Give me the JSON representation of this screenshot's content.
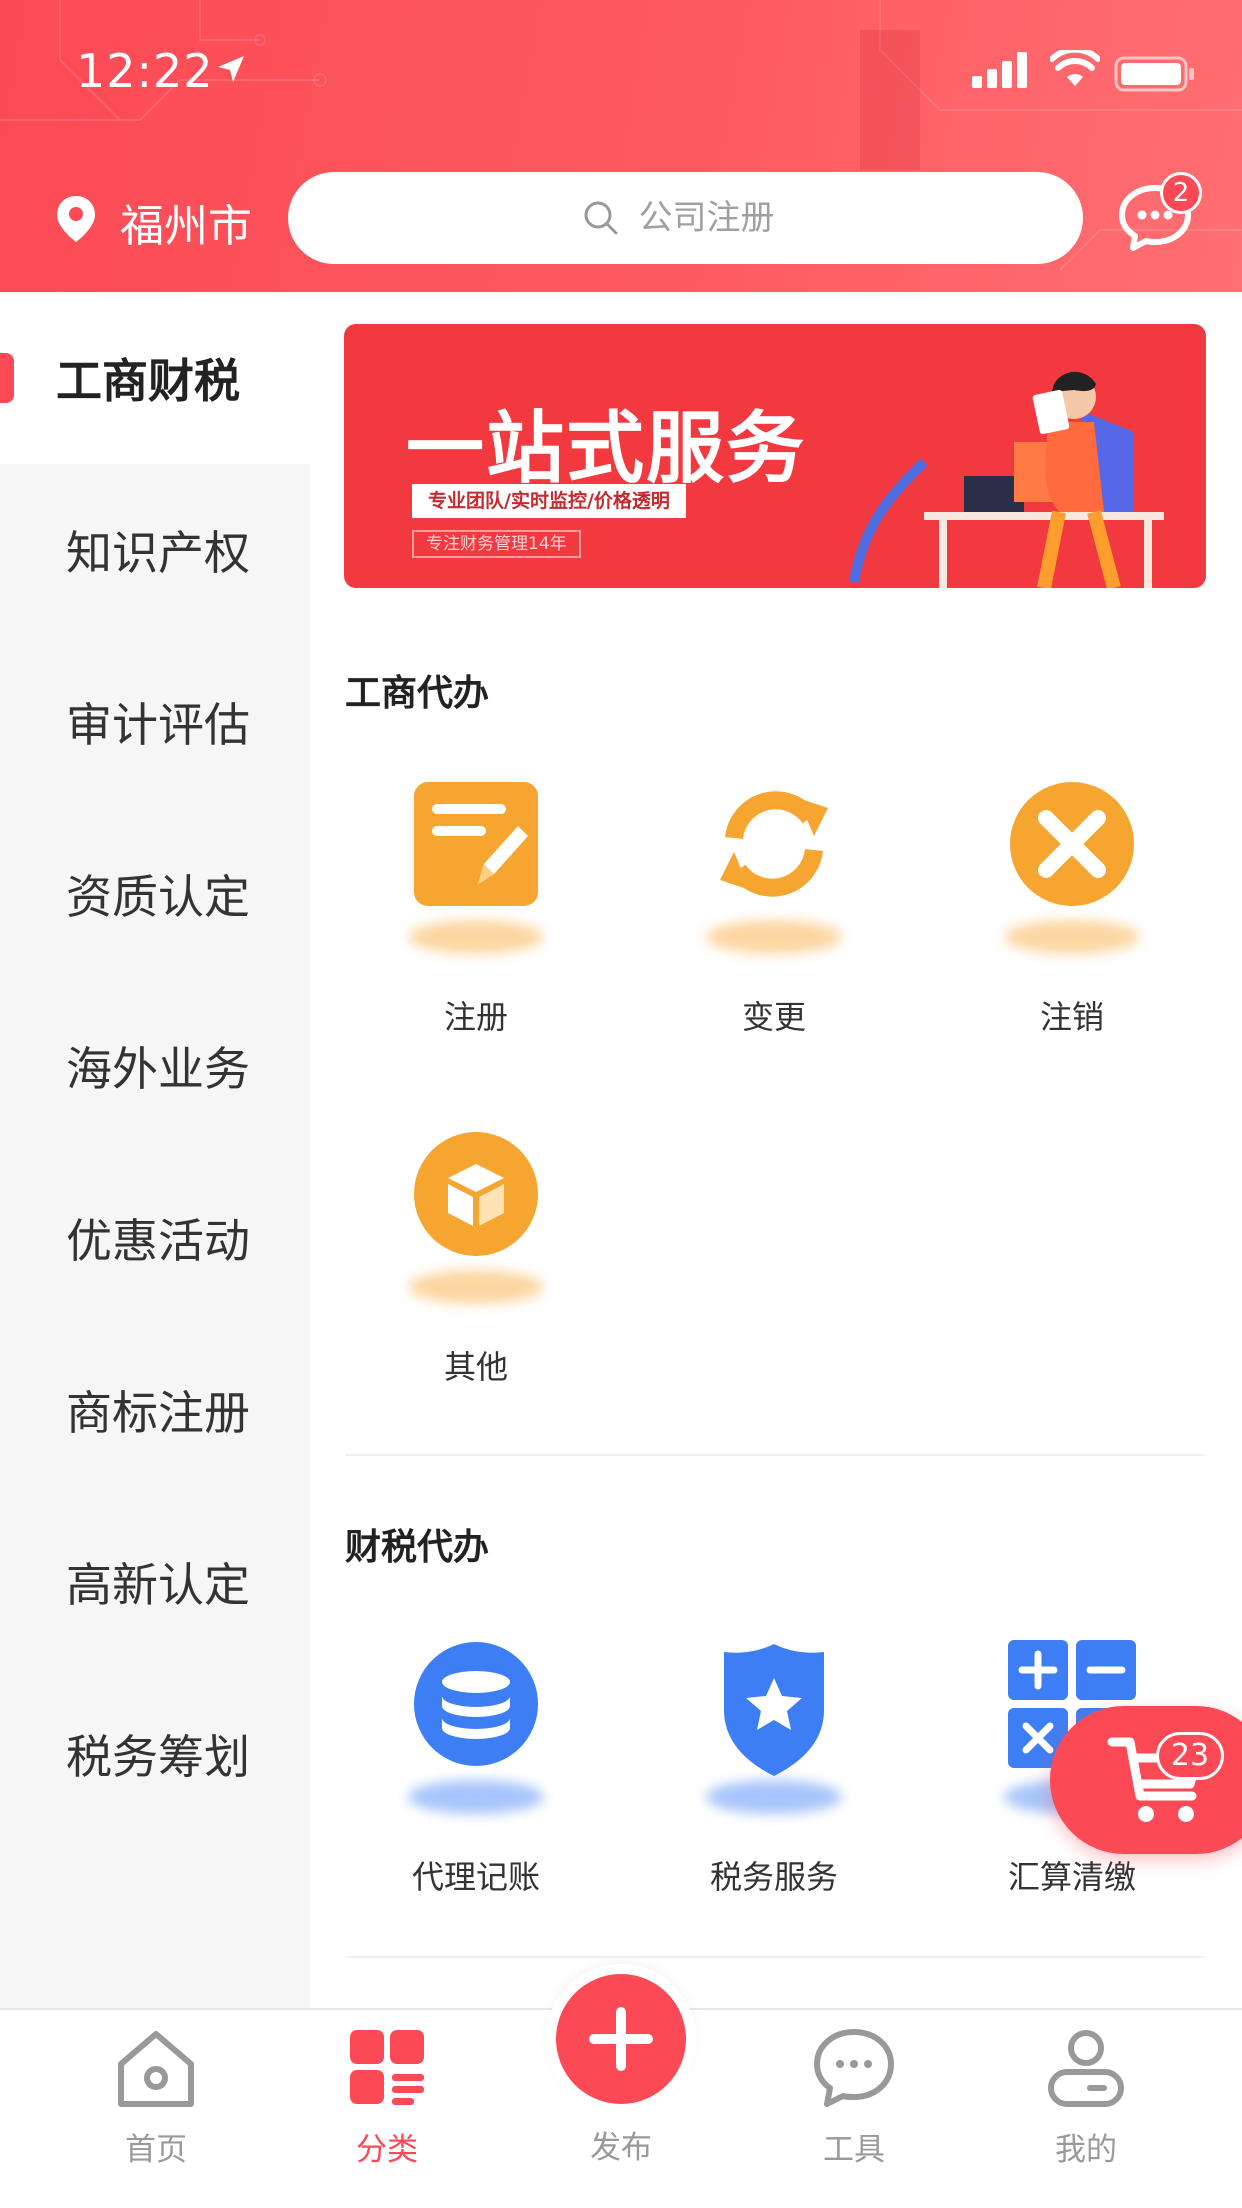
{
  "status_bar": {
    "time": "12:22"
  },
  "header": {
    "city": "福州市",
    "search_placeholder": "公司注册",
    "message_badge": "2"
  },
  "sidebar": {
    "items": [
      {
        "label": "工商财税",
        "active": true
      },
      {
        "label": "知识产权"
      },
      {
        "label": "审计评估"
      },
      {
        "label": "资质认定"
      },
      {
        "label": "海外业务"
      },
      {
        "label": "优惠活动"
      },
      {
        "label": "商标注册"
      },
      {
        "label": "高新认定"
      },
      {
        "label": "税务筹划"
      }
    ]
  },
  "banner": {
    "title": "一站式服务",
    "subtitle": "专业团队/实时监控/价格透明",
    "note": "专注财务管理14年"
  },
  "sections": [
    {
      "title": "工商代办",
      "items": [
        {
          "label": "注册",
          "icon": "edit-note-icon",
          "color": "#f7a531"
        },
        {
          "label": "变更",
          "icon": "refresh-icon",
          "color": "#f7a531"
        },
        {
          "label": "注销",
          "icon": "close-circle-icon",
          "color": "#f7a531"
        },
        {
          "label": "其他",
          "icon": "box-icon",
          "color": "#f7a531"
        }
      ]
    },
    {
      "title": "财税代办",
      "items": [
        {
          "label": "代理记账",
          "icon": "coin-stack-icon",
          "color": "#3d7ef5"
        },
        {
          "label": "税务服务",
          "icon": "shield-star-icon",
          "color": "#3d7ef5"
        },
        {
          "label": "汇算清缴",
          "icon": "calculator-icon",
          "color": "#3d7ef5"
        }
      ]
    }
  ],
  "cart": {
    "count": "23"
  },
  "tabbar": {
    "tabs": [
      {
        "label": "首页",
        "icon": "home-icon"
      },
      {
        "label": "分类",
        "icon": "category-icon",
        "active": true
      },
      {
        "label": "发布",
        "icon": "plus-icon"
      },
      {
        "label": "工具",
        "icon": "chat-bubble-icon"
      },
      {
        "label": "我的",
        "icon": "user-icon"
      }
    ]
  },
  "colors": {
    "accent": "#fb4a55",
    "orange": "#f7a531",
    "blue": "#3d7ef5"
  }
}
